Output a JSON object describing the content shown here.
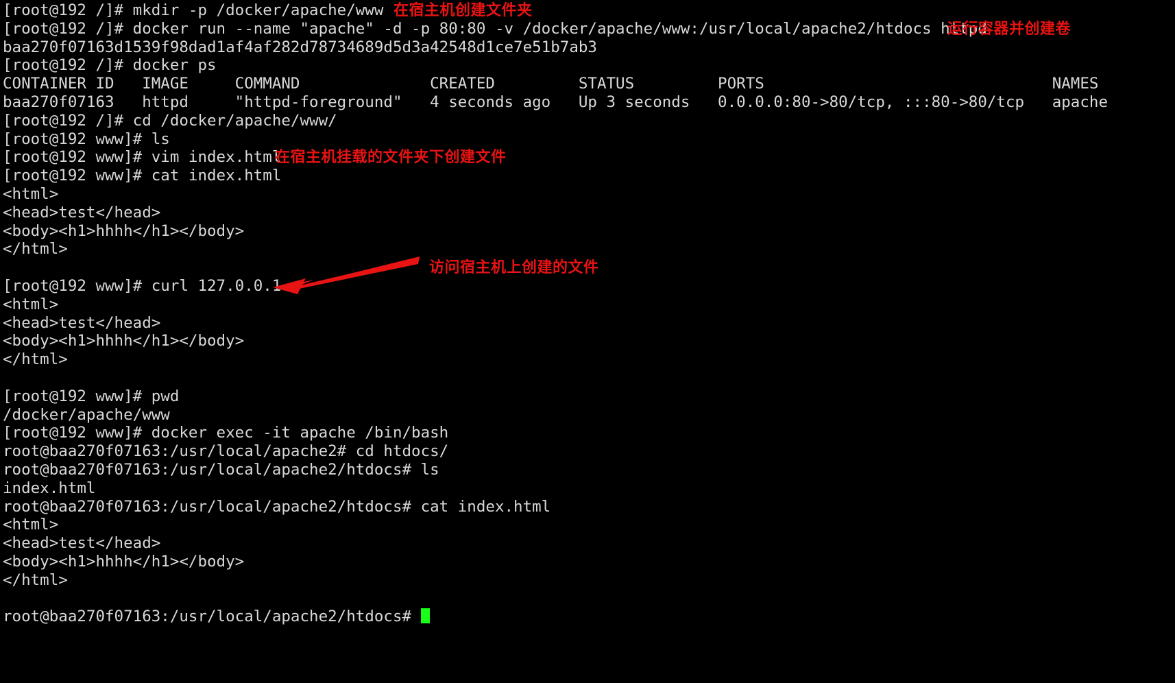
{
  "terminal": {
    "colors": {
      "background": "#000000",
      "foreground": "#d8d8d8",
      "annotation_red": "#e81313",
      "cursor_green": "#19ff19"
    },
    "lines": [
      {
        "text": "[root@192 /]# mkdir -p /docker/apache/www",
        "annotation": "在宿主机创建文件夹",
        "annotation_slot": "a1"
      },
      {
        "text": "[root@192 /]# docker run --name \"apache\" -d -p 80:80 -v /docker/apache/www:/usr/local/apache2/htdocs httpd",
        "annotation": "运行容器并创建卷",
        "annotation_slot": "a2"
      },
      {
        "text": "baa270f07163d1539f98dad1af4af282d78734689d5d3a42548d1ce7e51b7ab3"
      },
      {
        "text": "[root@192 /]# docker ps"
      },
      {
        "text": "CONTAINER ID   IMAGE     COMMAND              CREATED         STATUS         PORTS                               NAMES"
      },
      {
        "text": "baa270f07163   httpd     \"httpd-foreground\"   4 seconds ago   Up 3 seconds   0.0.0.0:80->80/tcp, :::80->80/tcp   apache"
      },
      {
        "text": "[root@192 /]# cd /docker/apache/www/"
      },
      {
        "text": "[root@192 www]# ls"
      },
      {
        "text": "[root@192 www]# vim index.html",
        "annotation": "在宿主机挂载的文件夹下创建文件",
        "annotation_slot": "a3"
      },
      {
        "text": "[root@192 www]# cat index.html"
      },
      {
        "text": "<html>"
      },
      {
        "text": "<head>test</head>"
      },
      {
        "text": "<body><h1>hhhh</h1></body>"
      },
      {
        "text": "</html>"
      },
      {
        "text": ""
      },
      {
        "text": "[root@192 www]# curl 127.0.0.1"
      },
      {
        "text": "<html>"
      },
      {
        "text": "<head>test</head>"
      },
      {
        "text": "<body><h1>hhhh</h1></body>"
      },
      {
        "text": "</html>"
      },
      {
        "text": ""
      },
      {
        "text": "[root@192 www]# pwd"
      },
      {
        "text": "/docker/apache/www"
      },
      {
        "text": "[root@192 www]# docker exec -it apache /bin/bash"
      },
      {
        "text": "root@baa270f07163:/usr/local/apache2# cd htdocs/"
      },
      {
        "text": "root@baa270f07163:/usr/local/apache2/htdocs# ls"
      },
      {
        "text": "index.html"
      },
      {
        "text": "root@baa270f07163:/usr/local/apache2/htdocs# cat index.html"
      },
      {
        "text": "<html>"
      },
      {
        "text": "<head>test</head>"
      },
      {
        "text": "<body><h1>hhhh</h1></body>"
      },
      {
        "text": "</html>"
      },
      {
        "text": ""
      },
      {
        "text": "root@baa270f07163:/usr/local/apache2/htdocs# ",
        "cursor": true
      }
    ],
    "floating_annotation": "访问宿主机上创建的文件",
    "docker_ps_table": {
      "headers": [
        "CONTAINER ID",
        "IMAGE",
        "COMMAND",
        "CREATED",
        "STATUS",
        "PORTS",
        "NAMES"
      ],
      "rows": [
        [
          "baa270f07163",
          "httpd",
          "\"httpd-foreground\"",
          "4 seconds ago",
          "Up 3 seconds",
          "0.0.0.0:80->80/tcp, :::80->80/tcp",
          "apache"
        ]
      ]
    }
  }
}
